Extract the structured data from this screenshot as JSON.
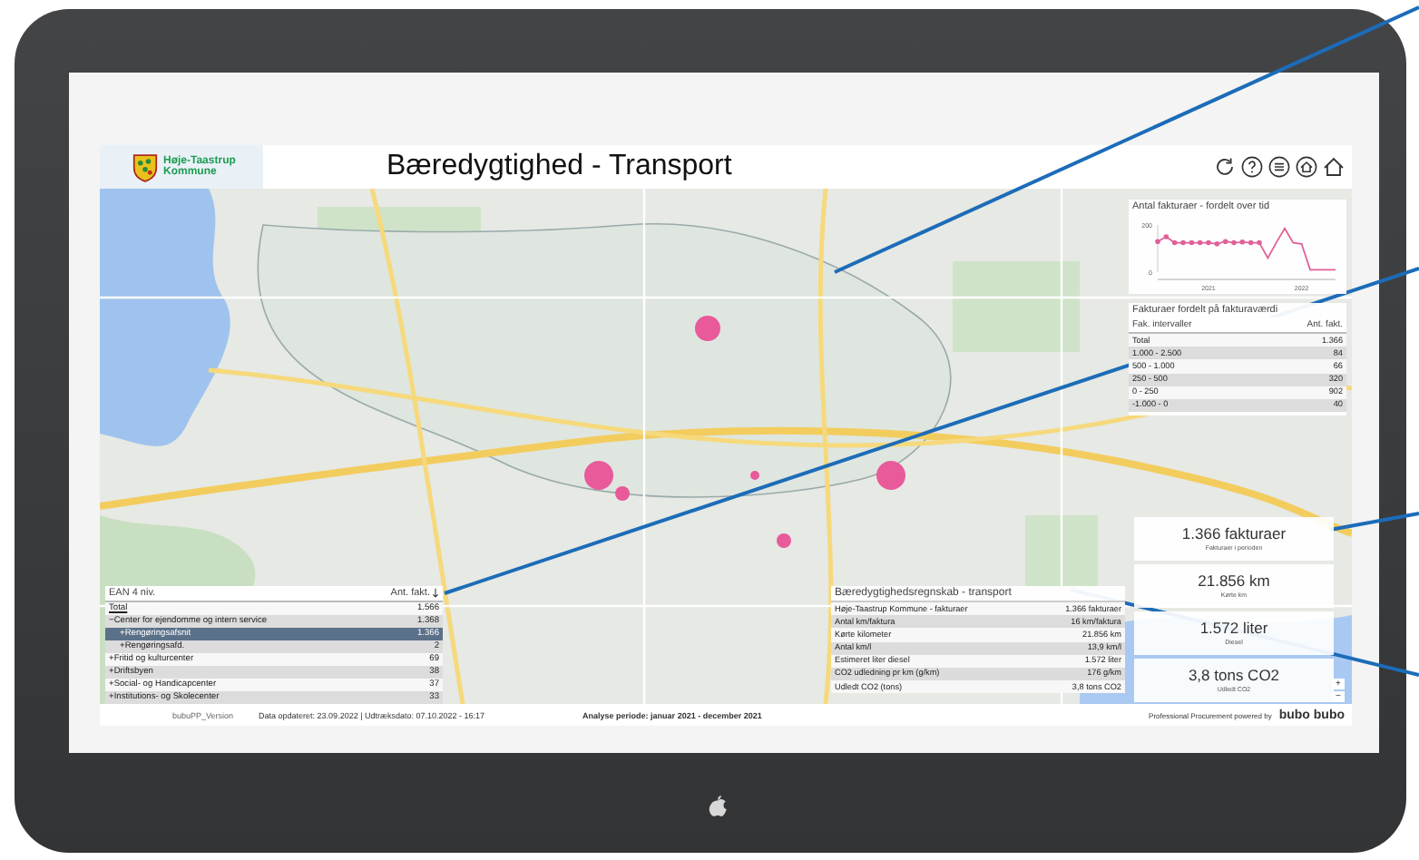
{
  "header": {
    "logo_lines": [
      "Høje-Taastrup",
      "Kommune"
    ],
    "title": "Bæredygtighed - Transport"
  },
  "chart_panel": {
    "title": "Antal fakturaer - fordelt over tid",
    "chart_data": {
      "type": "line",
      "categories": [
        null,
        null,
        null,
        null,
        null,
        null,
        "2021",
        null,
        null,
        null,
        null,
        null,
        null,
        null,
        null,
        null,
        null,
        "2022",
        null,
        null,
        null,
        null
      ],
      "ylim": [
        0,
        200
      ],
      "yticks": [
        0,
        200
      ],
      "series": [
        {
          "color": "#e0609a",
          "values": [
            130,
            150,
            125,
            125,
            125,
            125,
            125,
            120,
            130,
            125,
            128,
            125,
            125,
            60,
            125,
            185,
            125,
            120,
            10,
            10,
            10,
            10
          ]
        }
      ]
    }
  },
  "value_table": {
    "title": "Fakturaer fordelt på fakturaværdi",
    "columns": [
      "Fak. intervaller",
      "Ant. fakt."
    ],
    "rows": [
      {
        "label": "Total",
        "count": "1.366"
      },
      {
        "label": "1.000 - 2.500",
        "count": "84"
      },
      {
        "label": "500 - 1.000",
        "count": "66"
      },
      {
        "label": "250 - 500",
        "count": "320"
      },
      {
        "label": "0 - 250",
        "count": "902"
      },
      {
        "label": "-1.000 - 0",
        "count": "40"
      }
    ]
  },
  "ean_table": {
    "columns": [
      "EAN 4 niv.",
      "Ant. fakt."
    ],
    "rows": [
      {
        "kind": "total",
        "label": "Total",
        "count": "1.566",
        "selected": false
      },
      {
        "kind": "group",
        "toggle": "−",
        "label": "Center for ejendomme og intern service",
        "count": "1.368",
        "selected": false,
        "children": [
          {
            "kind": "group",
            "toggle": "+",
            "label": "Rengøringsafsnit",
            "count": "1.366",
            "selected": true
          },
          {
            "kind": "group",
            "toggle": "+",
            "label": "Rengøringsafd.",
            "count": "2",
            "selected": false
          }
        ]
      },
      {
        "kind": "group",
        "toggle": "+",
        "label": "Fritid og kulturcenter",
        "count": "69",
        "selected": false
      },
      {
        "kind": "group",
        "toggle": "+",
        "label": "Driftsbyen",
        "count": "38",
        "selected": false
      },
      {
        "kind": "group",
        "toggle": "+",
        "label": "Social- og Handicapcenter",
        "count": "37",
        "selected": false
      },
      {
        "kind": "group",
        "toggle": "+",
        "label": "Institutions- og Skolecenter",
        "count": "33",
        "selected": false
      }
    ]
  },
  "accounting_table": {
    "title": "Bæredygtighedsregnskab - transport",
    "rows": [
      {
        "label": "Høje-Taastrup Kommune - fakturaer",
        "value": "1.366 fakturaer"
      },
      {
        "label": "Antal km/faktura",
        "value": "16 km/faktura"
      },
      {
        "label": "Kørte kilometer",
        "value": "21.856 km"
      },
      {
        "label": "Antal km/l",
        "value": "13,9 km/l"
      },
      {
        "label": "Estimeret liter diesel",
        "value": "1.572 liter"
      },
      {
        "label": "CO2 udledning pr km (g/km)",
        "value": "176 g/km"
      },
      {
        "label": "Udledt CO2 (tons)",
        "value": "3,8 tons CO2"
      }
    ]
  },
  "kpis": [
    {
      "value": "1.366 fakturaer",
      "caption": "Fakturaer i perioden"
    },
    {
      "value": "21.856 km",
      "caption": "Kørte km"
    },
    {
      "value": "1.572 liter",
      "caption": "Diesel"
    },
    {
      "value": "3,8 tons CO2",
      "caption": "Udledt CO2"
    }
  ],
  "map_controls": [
    "+",
    "−"
  ],
  "footer": {
    "version": "bubuPP_Version",
    "updated": "Data opdateret: 23.09.2022 | Udtræksdato: 07.10.2022 - 16:17",
    "period": "Analyse periode: januar 2021 - december 2021",
    "powered": "Professional Procurement powered by",
    "brand": "bubo bubo"
  }
}
